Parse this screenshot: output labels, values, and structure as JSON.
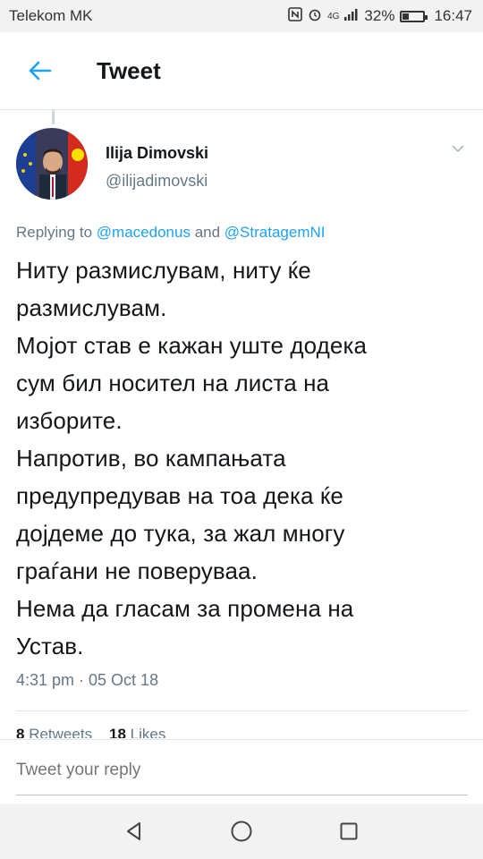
{
  "status_bar": {
    "carrier": "Telekom MK",
    "network": "4G",
    "battery": "32%",
    "battery_level": 0.32,
    "time": "16:47",
    "icons": [
      "nfc-icon",
      "alarm-icon",
      "signal-icon",
      "battery-icon"
    ]
  },
  "app_bar": {
    "title": "Tweet",
    "back_icon": "arrow-left-icon"
  },
  "tweet": {
    "author_name": "Ilija Dimovski",
    "author_handle": "@ilijadimovski",
    "replying_prefix": "Replying to",
    "mentions": [
      "@macedonus",
      "@StratagemNI"
    ],
    "replying_and": "and",
    "lines": [
      "Ниту размислувам, ниту ќе",
      "размислувам.",
      "Мојот став е кажан уште додека",
      "сум бил носител на листа на",
      "изборите.",
      "Напротив, во кампањата",
      "предупредував на тоа дека ќе",
      "дојдеме до тука, за жал многу",
      "граѓани не поверуваа.",
      "Нема да гласам за промена на",
      "Устав."
    ],
    "timestamp": "4:31 pm · 05 Oct 18",
    "retweets_count": "8",
    "retweets_label": "Retweets",
    "likes_count": "18",
    "likes_label": "Likes"
  },
  "reply": {
    "placeholder": "Tweet your reply"
  },
  "colors": {
    "accent": "#1da1f2",
    "secondary_text": "#657786",
    "primary_text": "#14171a"
  }
}
